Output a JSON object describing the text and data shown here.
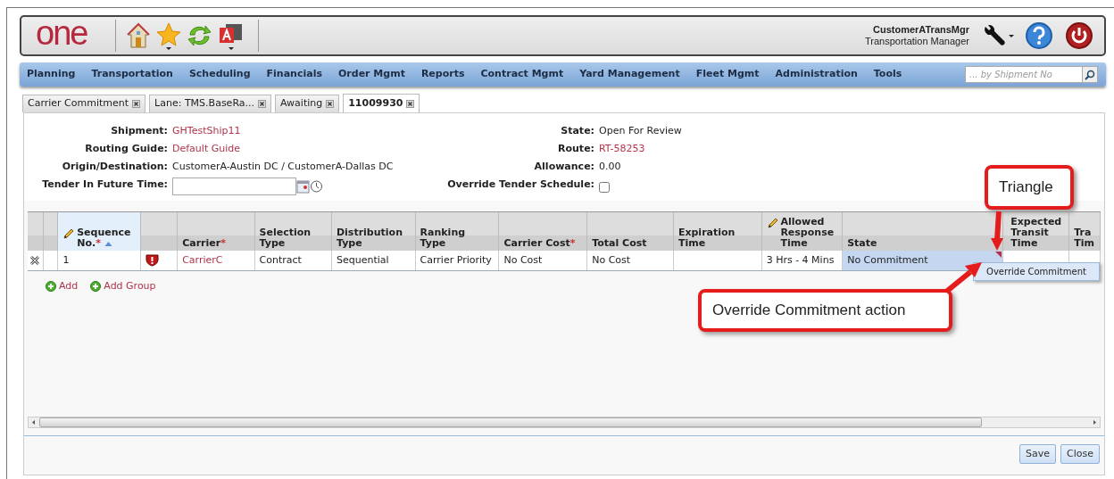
{
  "header": {
    "logo": "one",
    "user_name": "CustomerATransMgr",
    "user_role": "Transportation Manager"
  },
  "nav": {
    "items": [
      "Planning",
      "Transportation",
      "Scheduling",
      "Financials",
      "Order Mgmt",
      "Reports",
      "Contract Mgmt",
      "Yard Management",
      "Fleet Mgmt",
      "Administration",
      "Tools"
    ],
    "search_placeholder": "... by Shipment No"
  },
  "tabs": [
    {
      "label": "Carrier Commitment",
      "selected": false
    },
    {
      "label": "Lane: TMS.BaseRa...",
      "selected": false
    },
    {
      "label": "Awaiting",
      "selected": false
    },
    {
      "label": "11009930",
      "selected": true
    }
  ],
  "form": {
    "left": [
      {
        "label": "Shipment:",
        "value": "GHTestShip11",
        "kind": "link"
      },
      {
        "label": "Routing Guide:",
        "value": "Default Guide",
        "kind": "link"
      },
      {
        "label": "Origin/Destination:",
        "value": "CustomerA-Austin DC / CustomerA-Dallas DC",
        "kind": "text"
      },
      {
        "label": "Tender In Future Time:",
        "kind": "datetime"
      }
    ],
    "right": [
      {
        "label": "State:",
        "value": "Open For Review",
        "kind": "text"
      },
      {
        "label": "Route:",
        "value": "RT-58253",
        "kind": "link"
      },
      {
        "label": "Allowance:",
        "value": "0.00",
        "kind": "text"
      },
      {
        "label": "Override Tender Schedule:",
        "kind": "checkbox",
        "checked": false
      }
    ]
  },
  "grid": {
    "columns": [
      {
        "label": "Sequence No.",
        "kind": "text",
        "required_mark": "*",
        "editable": true,
        "sorted": true
      },
      {
        "kind": "icon"
      },
      {
        "label": "Carrier",
        "kind": "link",
        "required_mark": "*",
        "editable": false,
        "sorted": false
      },
      {
        "label": "Selection Type",
        "kind": "text",
        "editable": false,
        "sorted": false
      },
      {
        "label": "Distribution Type",
        "kind": "text",
        "editable": false,
        "sorted": false
      },
      {
        "label": "Ranking Type",
        "kind": "text",
        "editable": false,
        "sorted": false
      },
      {
        "label": "Carrier Cost",
        "kind": "text",
        "required_mark": "*",
        "editable": false,
        "sorted": false
      },
      {
        "label": "Total Cost",
        "kind": "text",
        "editable": false,
        "sorted": false
      },
      {
        "label": "Expiration Time",
        "kind": "text",
        "editable": false,
        "sorted": false
      },
      {
        "label": "Allowed Response Time",
        "kind": "text",
        "editable": true,
        "sorted": false
      },
      {
        "label": "State",
        "kind": "state",
        "editable": false,
        "sorted": false
      },
      {
        "label": "Expected Transit Time",
        "kind": "text",
        "editable": false,
        "sorted": false
      },
      {
        "label": "Tra Tim",
        "kind": "text",
        "editable": false,
        "sorted": false
      }
    ],
    "rows": [
      {
        "cells": {
          "0": "1",
          "2": "CarrierC",
          "3": "Contract",
          "4": "Sequential",
          "5": "Carrier Priority",
          "6": "No Cost",
          "7": "No Cost",
          "9": "3 Hrs - 4 Mins",
          "10": "No Commitment"
        },
        "selected_state": true,
        "warning": true
      }
    ],
    "actions": [
      "Add",
      "Add Group"
    ]
  },
  "context_menu": {
    "items": [
      "Override Commitment"
    ]
  },
  "footer": {
    "buttons": [
      "Save",
      "Close"
    ]
  },
  "callouts": [
    "Triangle",
    "Override Commitment action"
  ]
}
